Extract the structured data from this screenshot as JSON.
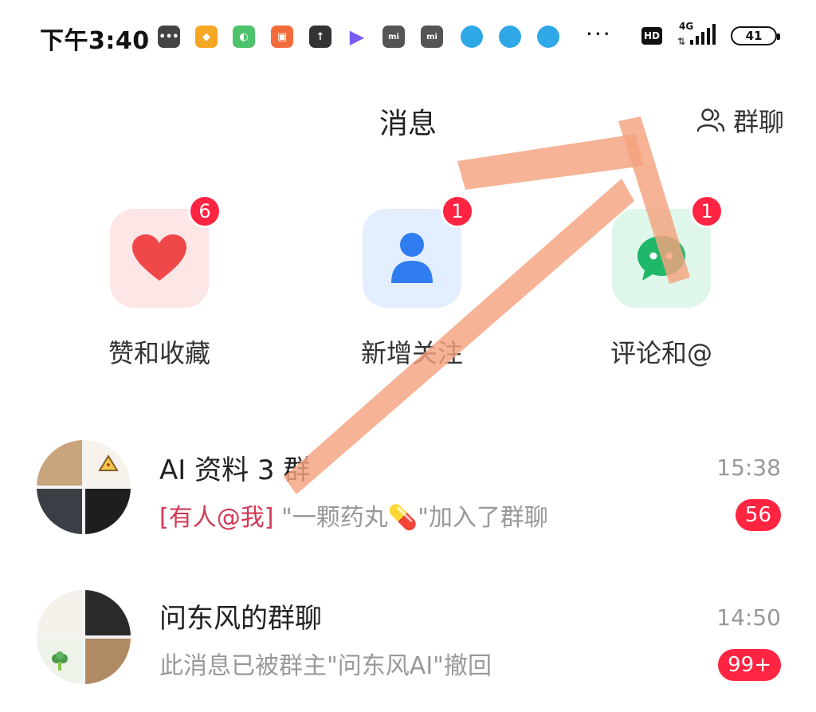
{
  "status_bar": {
    "time": "下午3:40",
    "network": "4G",
    "hd": "HD",
    "battery": "41",
    "overflow": "···"
  },
  "header": {
    "title": "消息",
    "group_chat_label": "群聊"
  },
  "categories": [
    {
      "label": "赞和收藏",
      "badge": "6",
      "icon": "heart-icon",
      "tile_color": "#fde6e6",
      "icon_color": "#f04848"
    },
    {
      "label": "新增关注",
      "badge": "1",
      "icon": "person-icon",
      "tile_color": "#e3eefe",
      "icon_color": "#2f7df0"
    },
    {
      "label": "评论和@",
      "badge": "1",
      "icon": "chat-bubble-icon",
      "tile_color": "#dff6ea",
      "icon_color": "#1fb86a"
    }
  ],
  "chats": [
    {
      "name": "AI 资料 3 群",
      "time": "15:38",
      "mention": "[有人@我]",
      "message": "\"一颗药丸💊\"加入了群聊",
      "unread": "56"
    },
    {
      "name": "问东风的群聊",
      "time": "14:50",
      "mention": "",
      "message": "此消息已被群主\"问东风AI\"撤回",
      "unread": "99+"
    }
  ],
  "colors": {
    "badge": "#ff2442",
    "mention": "#d23a55",
    "annotation_arrow": "#f5a27e"
  }
}
